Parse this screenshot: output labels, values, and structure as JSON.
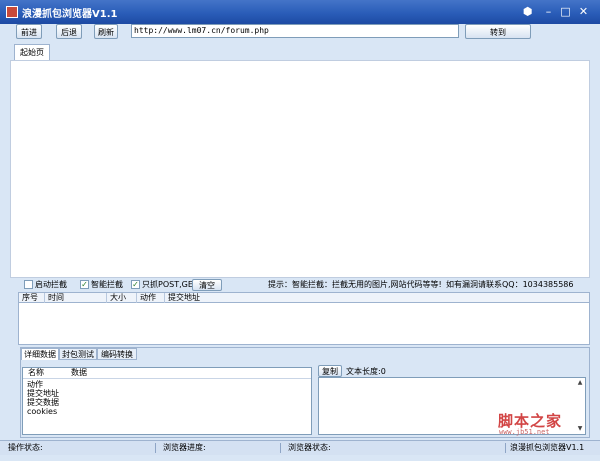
{
  "window": {
    "title": "浪漫抓包浏览器V1.1",
    "controls": {
      "minimize": "–",
      "maximize": "□",
      "close": "✕"
    }
  },
  "toolbar": {
    "back_label": "前进",
    "forward_label": "后退",
    "refresh_label": "刷新",
    "url_value": "http://www.lm07.cn/forum.php",
    "go_label": "转到"
  },
  "tabs": {
    "home": "起始页"
  },
  "options": {
    "start_intercept": "启动拦截",
    "smart_intercept": "智能拦截",
    "only_post_get": "只抓POST,GET",
    "clear_label": "清空",
    "tip": "提示：智能拦截：拦截无用的图片,网站代码等等!",
    "contact": "如有漏洞请联系QQ：1034385586",
    "start_checked": false,
    "smart_checked": true,
    "postget_checked": true
  },
  "grid": {
    "columns": [
      "序号",
      "时间",
      "大小",
      "动作",
      "提交地址"
    ]
  },
  "detail": {
    "tabs": [
      "详细数据",
      "封包测试",
      "编码转换"
    ],
    "columns": [
      "名称",
      "数据"
    ],
    "items": [
      "动作",
      "提交地址",
      "提交数据",
      "cookies"
    ],
    "copy_label": "复制",
    "text_length_label": "文本长度:0"
  },
  "status": {
    "operation": "操作状态:",
    "progress": "浏览器进度:",
    "browser_state": "浏览器状态:",
    "app_name": "浪漫抓包浏览器V1.1"
  },
  "watermark": {
    "main": "脚本之家",
    "url": "www.jb51.net"
  },
  "colors": {
    "titlebar": "#2a5db8",
    "window_bg": "#d9e6f5",
    "accent": "#7f9db9"
  }
}
